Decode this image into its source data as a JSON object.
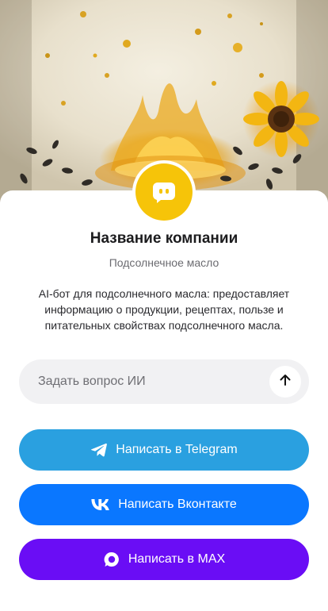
{
  "hero": {
    "image": "sunflower-oil-splash"
  },
  "company": {
    "avatar_icon": "chat-bot-icon",
    "name": "Название компании",
    "category": "Подсолнечное масло",
    "description": "AI-бот для подсолнечного масла: предоставляет информацию о продукции, рецептах, пользе и питательных свойствах подсолнечного масла."
  },
  "ask": {
    "placeholder": "Задать вопрос ИИ",
    "send_icon": "arrow-up-icon"
  },
  "buttons": {
    "telegram": {
      "label": "Написать в Telegram",
      "icon": "telegram-icon",
      "color": "#2aa0e0"
    },
    "vk": {
      "label": "Написать Вконтакте",
      "icon": "vk-icon",
      "color": "#0a77ff"
    },
    "max": {
      "label": "Написать в MAX",
      "icon": "max-icon",
      "color": "#6a0df5"
    }
  },
  "colors": {
    "accent_yellow": "#f6c409"
  }
}
